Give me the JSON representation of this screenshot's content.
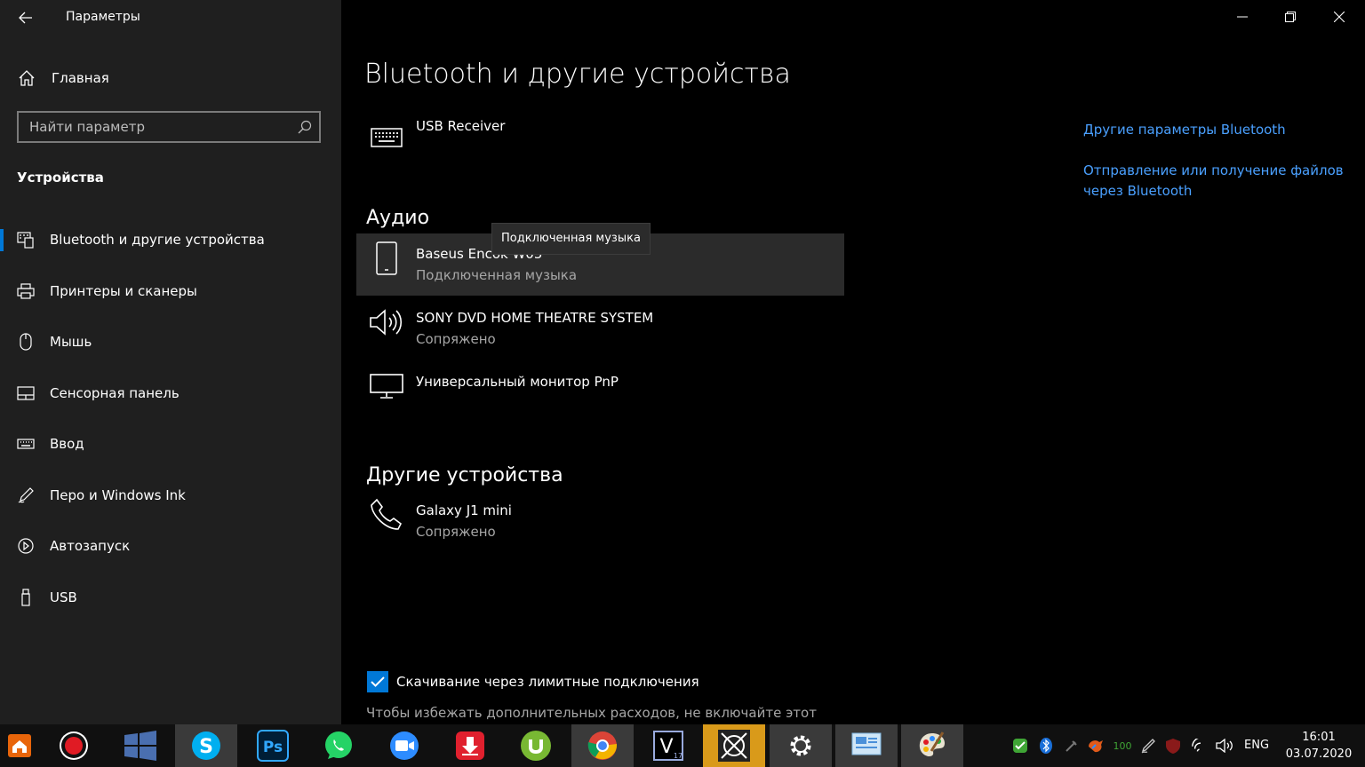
{
  "window": {
    "title": "Параметры"
  },
  "sidebar": {
    "home_label": "Главная",
    "search_placeholder": "Найти параметр",
    "section": "Устройства",
    "items": [
      {
        "label": "Bluetooth и другие устройства",
        "icon": "bluetooth-devices-icon",
        "active": true
      },
      {
        "label": "Принтеры и сканеры",
        "icon": "printer-icon"
      },
      {
        "label": "Мышь",
        "icon": "mouse-icon"
      },
      {
        "label": "Сенсорная панель",
        "icon": "touchpad-icon"
      },
      {
        "label": "Ввод",
        "icon": "keyboard-icon"
      },
      {
        "label": "Перо и Windows Ink",
        "icon": "pen-icon"
      },
      {
        "label": "Автозапуск",
        "icon": "autoplay-icon"
      },
      {
        "label": "USB",
        "icon": "usb-icon"
      }
    ]
  },
  "main": {
    "title": "Bluetooth и другие устройства",
    "top_device": {
      "name": "USB Receiver",
      "icon": "keyboard-icon"
    },
    "audio_heading": "Аудио",
    "audio_devices": [
      {
        "name": "Baseus Encok W05",
        "status": "Подключенная музыка",
        "icon": "phone-icon"
      },
      {
        "name": "SONY DVD HOME THEATRE SYSTEM",
        "status": "Сопряжено",
        "icon": "speaker-icon"
      },
      {
        "name": "Универсальный монитор PnP",
        "status": "",
        "icon": "monitor-icon"
      }
    ],
    "other_heading": "Другие устройства",
    "other_devices": [
      {
        "name": "Galaxy J1 mini",
        "status": "Сопряжено",
        "icon": "phone-call-icon"
      }
    ],
    "tooltip": "Подключенная музыка",
    "related_links": [
      "Другие параметры Bluetooth",
      "Отправление или получение файлов через Bluetooth"
    ],
    "metered_checkbox": {
      "label": "Скачивание через лимитные подключения",
      "checked": true
    },
    "metered_note": "Чтобы избежать дополнительных расходов, не включайте этот"
  },
  "taskbar": {
    "apps": [
      "home-app-icon",
      "record-app-icon",
      "windows-app-icon",
      "skype-icon",
      "photoshop-icon",
      "whatsapp-icon",
      "zoom-icon",
      "downloader-icon",
      "utorrent-icon",
      "chrome-icon",
      "vegas-icon",
      "crosshair-app-icon",
      "settings-icon",
      "control-panel-icon",
      "paint-icon"
    ],
    "battery_text": "100",
    "language": "ENG",
    "time": "16:01",
    "date": "03.07.2020"
  },
  "colors": {
    "accent": "#0078d7",
    "link": "#4aa0ff",
    "sidebar_bg": "#1f1f1f",
    "main_bg": "#000000"
  }
}
